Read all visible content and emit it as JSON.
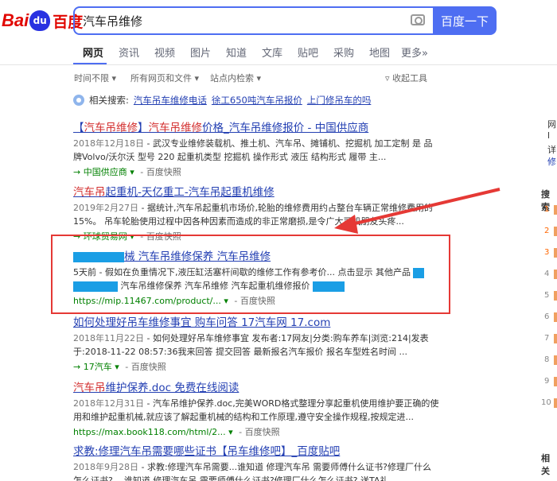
{
  "logo": {
    "bai": "Bai",
    "du": "du",
    "paw_text": "du",
    "cn": "百度"
  },
  "search": {
    "query": "汽车吊维修",
    "button": "百度一下"
  },
  "tabs": [
    "网页",
    "资讯",
    "视频",
    "图片",
    "知道",
    "文库",
    "贴吧",
    "采购",
    "地图",
    "更多»"
  ],
  "filters": {
    "time": "时间不限",
    "format": "所有网页和文件",
    "site": "站点内检索",
    "collapse": "收起工具"
  },
  "related": {
    "label": "相关搜索:",
    "links": [
      "汽车吊车维修电话",
      "徐工650吨汽车吊报价",
      "上门修吊车的吗"
    ]
  },
  "results": [
    {
      "title_pre": "【",
      "title_em1": "汽车吊维修",
      "title_mid": "】",
      "title_em2": "汽车吊维修",
      "title_rest": "价格_汽车吊维修报价 - 中国供应商",
      "date": "2018年12月18日",
      "abstract": " - 武汉专业维修装载机、推土机、汽车吊、摊铺机、挖掘机 加工定制 是 品牌Volvo/沃尔沃 型号 220 起重机类型 挖掘机 操作形式 液压 结构形式 履带 主...",
      "source": "中国供应商",
      "snapshot": "百度快照"
    },
    {
      "title_em": "汽车吊",
      "title_rest": "起重机-天亿重工-汽车吊起重机维修",
      "date": "2019年2月27日",
      "abstract": " - 据统计,汽车吊起重机市场价,轮胎的维修费用约占整台车辆正常维修费用的15%。 吊车轮胎使用过程中因各种因素而造成的非正常磨损,是令广大司机朋友头疼...",
      "source": "环球贸易网",
      "snapshot": "百度快照"
    },
    {
      "title_mid": "械 汽车吊维修保养 汽车吊维修",
      "abstract": "5天前 - 假如在负重情况下,液压缸活塞杆间歇的维修工作有参考价... 点击显示 其他产品",
      "abstract2": "汽车吊维修保养 汽车吊维修 汽车起重机维修报价",
      "url": "https://mip.11467.com/product/...",
      "snapshot": "百度快照"
    },
    {
      "title": "如何处理好吊车维修事宜 购车问答 17汽车网 17.com",
      "date": "2018年11月22日",
      "abstract": " - 如何处理好吊车维修事宜 发布者:17网友|分类:购车养车|浏览:214|发表于:2018-11-22 08:57:36我来回答 提交回答 最新报名汽车报价 报名车型姓名时间 ...",
      "source": "17汽车",
      "snapshot": "百度快照"
    },
    {
      "title_em": "汽车吊",
      "title_rest": "维护保养.doc 免费在线阅读",
      "date": "2018年12月31日",
      "abstract": " - 汽车吊维护保养.doc,完美WORD格式整理分享起重机使用维护要正确的使用和维护起重机械,就应该了解起重机械的结构和工作原理,遵守安全操作规程,按规定进...",
      "url": "https://max.book118.com/html/2...",
      "snapshot": "百度快照"
    },
    {
      "title": "求教:修理汽车吊需要哪些证书【吊车维修吧】_百度贴吧",
      "date": "2018年9月28日",
      "abstract": " - 求教:修理汽车吊需要...谁知道 修理汽车吊 需要师傅什么证书?修理厂什么怎么证书?... 谁知道 修理汽车吊 需要师傅什么证书?修理厂什么怎么证书? 送TA礼..."
    }
  ],
  "sidebar": {
    "t1": "网",
    "t2": "l",
    "t3": "详",
    "t4": "修",
    "search_label": "搜索",
    "nums": [
      "1",
      "2",
      "3",
      "4",
      "5",
      "6",
      "7",
      "8",
      "9",
      "10"
    ],
    "related_label": "相关"
  },
  "colors": {
    "accent": "#4e6ef2",
    "link": "#2440b3",
    "em": "#d32f2f",
    "redact": "#1a9ee5",
    "highlight": "#e53935"
  }
}
